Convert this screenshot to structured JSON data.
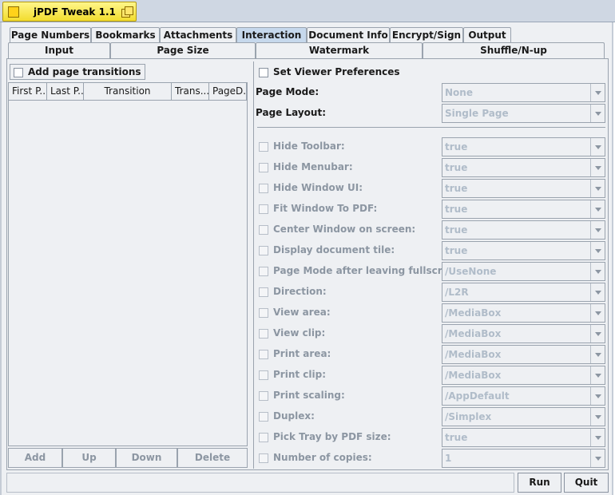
{
  "window": {
    "title": "jPDF Tweak 1.1"
  },
  "tabs_row1": [
    {
      "label": "Page Numbers",
      "selected": false
    },
    {
      "label": "Bookmarks",
      "selected": false
    },
    {
      "label": "Attachments",
      "selected": false
    },
    {
      "label": "Interaction",
      "selected": true
    },
    {
      "label": "Document Info",
      "selected": false
    },
    {
      "label": "Encrypt/Sign",
      "selected": false
    },
    {
      "label": "Output",
      "selected": false
    }
  ],
  "tabs_row2": [
    {
      "label": "Input"
    },
    {
      "label": "Page Size"
    },
    {
      "label": "Watermark"
    },
    {
      "label": "Shuffle/N-up"
    }
  ],
  "transitions": {
    "checkbox_label": "Add page transitions",
    "columns": [
      "First P...",
      "Last P...",
      "Transition",
      "Trans...",
      "PageD..."
    ],
    "buttons": [
      "Add",
      "Up",
      "Down",
      "Delete"
    ]
  },
  "viewer": {
    "checkbox_label": "Set Viewer Preferences",
    "page_mode_label": "Page Mode:",
    "page_mode_value": "None",
    "page_layout_label": "Page Layout:",
    "page_layout_value": "Single Page",
    "options": [
      {
        "label": "Hide Toolbar:",
        "value": "true"
      },
      {
        "label": "Hide Menubar:",
        "value": "true"
      },
      {
        "label": "Hide Window UI:",
        "value": "true"
      },
      {
        "label": "Fit Window To PDF:",
        "value": "true"
      },
      {
        "label": "Center Window on screen:",
        "value": "true"
      },
      {
        "label": "Display document tile:",
        "value": "true"
      },
      {
        "label": "Page Mode after leaving fullscreen:",
        "value": "/UseNone"
      },
      {
        "label": "Direction:",
        "value": "/L2R"
      },
      {
        "label": "View area:",
        "value": "/MediaBox"
      },
      {
        "label": "View clip:",
        "value": "/MediaBox"
      },
      {
        "label": "Print area:",
        "value": "/MediaBox"
      },
      {
        "label": "Print clip:",
        "value": "/MediaBox"
      },
      {
        "label": "Print scaling:",
        "value": "/AppDefault"
      },
      {
        "label": "Duplex:",
        "value": "/Simplex"
      },
      {
        "label": "Pick Tray by PDF size:",
        "value": "true"
      },
      {
        "label": "Number of copies:",
        "value": "1"
      }
    ]
  },
  "bottom": {
    "run_label": "Run",
    "quit_label": "Quit"
  },
  "colors": {
    "title_tab": "#f2dc2e",
    "selected_tab": "#c6d8ec",
    "disabled_text": "#b0bcc9"
  }
}
